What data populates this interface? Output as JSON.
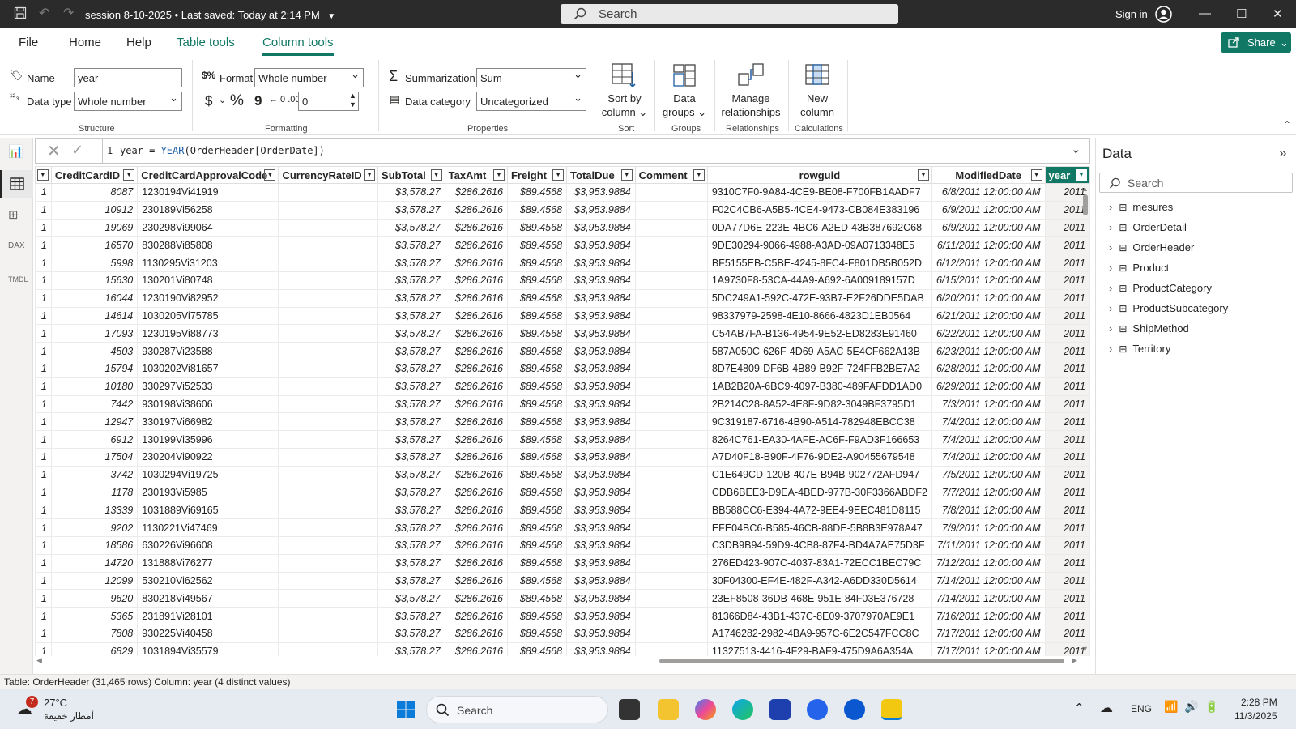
{
  "titlebar": {
    "title": "session 8-10-2025",
    "saved": "Last saved: Today at 2:14 PM",
    "search_placeholder": "Search",
    "signin": "Sign in"
  },
  "menu": {
    "items": [
      "File",
      "Home",
      "Help",
      "Table tools",
      "Column tools"
    ],
    "share": "Share"
  },
  "ribbon": {
    "structure": {
      "name_label": "Name",
      "name_value": "year",
      "datatype_label": "Data type",
      "datatype_value": "Whole number",
      "group": "Structure"
    },
    "formatting": {
      "format_label": "Format",
      "format_value": "Whole number",
      "currency_symbol": "$",
      "percent_symbol": "%",
      "comma_symbol": "9",
      "decimals_value": "0",
      "group": "Formatting"
    },
    "properties": {
      "summarization_label": "Summarization",
      "summarization_value": "Sum",
      "category_label": "Data category",
      "category_value": "Uncategorized",
      "group": "Properties"
    },
    "sort": {
      "btn1": "Sort by",
      "btn2": "column",
      "group": "Sort"
    },
    "groups": {
      "btn1": "Data",
      "btn2": "groups",
      "group": "Groups"
    },
    "relationships": {
      "btn1": "Manage",
      "btn2": "relationships",
      "group": "Relationships"
    },
    "calculations": {
      "btn1": "New",
      "btn2": "column",
      "group": "Calculations"
    }
  },
  "formula": {
    "line": "1",
    "lhs": "year = ",
    "fn": "YEAR",
    "args": "(OrderHeader[OrderDate])"
  },
  "table": {
    "columns": [
      "CreditCardID",
      "CreditCardApprovalCode",
      "CurrencyRateID",
      "SubTotal",
      "TaxAmt",
      "Freight",
      "TotalDue",
      "Comment",
      "rowguid",
      "ModifiedDate",
      "year"
    ],
    "rows": [
      [
        "1",
        "8087",
        "1230194Vi41919",
        "",
        "$3,578.27",
        "$286.2616",
        "$89.4568",
        "$3,953.9884",
        "",
        "9310C7F0-9A84-4CE9-BE08-F700FB1AADF7",
        "6/8/2011 12:00:00 AM",
        "2011"
      ],
      [
        "1",
        "10912",
        "230189Vi56258",
        "",
        "$3,578.27",
        "$286.2616",
        "$89.4568",
        "$3,953.9884",
        "",
        "F02C4CB6-A5B5-4CE4-9473-CB084E383196",
        "6/9/2011 12:00:00 AM",
        "2011"
      ],
      [
        "1",
        "19069",
        "230298Vi99064",
        "",
        "$3,578.27",
        "$286.2616",
        "$89.4568",
        "$3,953.9884",
        "",
        "0DA77D6E-223E-4BC6-A2ED-43B387692C68",
        "6/9/2011 12:00:00 AM",
        "2011"
      ],
      [
        "1",
        "16570",
        "830288Vi85808",
        "",
        "$3,578.27",
        "$286.2616",
        "$89.4568",
        "$3,953.9884",
        "",
        "9DE30294-9066-4988-A3AD-09A0713348E5",
        "6/11/2011 12:00:00 AM",
        "2011"
      ],
      [
        "1",
        "5998",
        "1130295Vi31203",
        "",
        "$3,578.27",
        "$286.2616",
        "$89.4568",
        "$3,953.9884",
        "",
        "BF5155EB-C5BE-4245-8FC4-F801DB5B052D",
        "6/12/2011 12:00:00 AM",
        "2011"
      ],
      [
        "1",
        "15630",
        "130201Vi80748",
        "",
        "$3,578.27",
        "$286.2616",
        "$89.4568",
        "$3,953.9884",
        "",
        "1A9730F8-53CA-44A9-A692-6A009189157D",
        "6/15/2011 12:00:00 AM",
        "2011"
      ],
      [
        "1",
        "16044",
        "1230190Vi82952",
        "",
        "$3,578.27",
        "$286.2616",
        "$89.4568",
        "$3,953.9884",
        "",
        "5DC249A1-592C-472E-93B7-E2F26DDE5DAB",
        "6/20/2011 12:00:00 AM",
        "2011"
      ],
      [
        "1",
        "14614",
        "1030205Vi75785",
        "",
        "$3,578.27",
        "$286.2616",
        "$89.4568",
        "$3,953.9884",
        "",
        "98337979-2598-4E10-8666-4823D1EB0564",
        "6/21/2011 12:00:00 AM",
        "2011"
      ],
      [
        "1",
        "17093",
        "1230195Vi88773",
        "",
        "$3,578.27",
        "$286.2616",
        "$89.4568",
        "$3,953.9884",
        "",
        "C54AB7FA-B136-4954-9E52-ED8283E91460",
        "6/22/2011 12:00:00 AM",
        "2011"
      ],
      [
        "1",
        "4503",
        "930287Vi23588",
        "",
        "$3,578.27",
        "$286.2616",
        "$89.4568",
        "$3,953.9884",
        "",
        "587A050C-626F-4D69-A5AC-5E4CF662A13B",
        "6/23/2011 12:00:00 AM",
        "2011"
      ],
      [
        "1",
        "15794",
        "1030202Vi81657",
        "",
        "$3,578.27",
        "$286.2616",
        "$89.4568",
        "$3,953.9884",
        "",
        "8D7E4809-DF6B-4B89-B92F-724FFB2BE7A2",
        "6/28/2011 12:00:00 AM",
        "2011"
      ],
      [
        "1",
        "10180",
        "330297Vi52533",
        "",
        "$3,578.27",
        "$286.2616",
        "$89.4568",
        "$3,953.9884",
        "",
        "1AB2B20A-6BC9-4097-B380-489FAFDD1AD0",
        "6/29/2011 12:00:00 AM",
        "2011"
      ],
      [
        "1",
        "7442",
        "930198Vi38606",
        "",
        "$3,578.27",
        "$286.2616",
        "$89.4568",
        "$3,953.9884",
        "",
        "2B214C28-8A52-4E8F-9D82-3049BF3795D1",
        "7/3/2011 12:00:00 AM",
        "2011"
      ],
      [
        "1",
        "12947",
        "330197Vi66982",
        "",
        "$3,578.27",
        "$286.2616",
        "$89.4568",
        "$3,953.9884",
        "",
        "9C319187-6716-4B90-A514-782948EBCC38",
        "7/4/2011 12:00:00 AM",
        "2011"
      ],
      [
        "1",
        "6912",
        "130199Vi35996",
        "",
        "$3,578.27",
        "$286.2616",
        "$89.4568",
        "$3,953.9884",
        "",
        "8264C761-EA30-4AFE-AC6F-F9AD3F166653",
        "7/4/2011 12:00:00 AM",
        "2011"
      ],
      [
        "1",
        "17504",
        "230204Vi90922",
        "",
        "$3,578.27",
        "$286.2616",
        "$89.4568",
        "$3,953.9884",
        "",
        "A7D40F18-B90F-4F76-9DE2-A90455679548",
        "7/4/2011 12:00:00 AM",
        "2011"
      ],
      [
        "1",
        "3742",
        "1030294Vi19725",
        "",
        "$3,578.27",
        "$286.2616",
        "$89.4568",
        "$3,953.9884",
        "",
        "C1E649CD-120B-407E-B94B-902772AFD947",
        "7/5/2011 12:00:00 AM",
        "2011"
      ],
      [
        "1",
        "1178",
        "230193Vi5985",
        "",
        "$3,578.27",
        "$286.2616",
        "$89.4568",
        "$3,953.9884",
        "",
        "CDB6BEE3-D9EA-4BED-977B-30F3366ABDF2",
        "7/7/2011 12:00:00 AM",
        "2011"
      ],
      [
        "1",
        "13339",
        "1031889Vi69165",
        "",
        "$3,578.27",
        "$286.2616",
        "$89.4568",
        "$3,953.9884",
        "",
        "BB588CC6-E394-4A72-9EE4-9EEC481D8115",
        "7/8/2011 12:00:00 AM",
        "2011"
      ],
      [
        "1",
        "9202",
        "1130221Vi47469",
        "",
        "$3,578.27",
        "$286.2616",
        "$89.4568",
        "$3,953.9884",
        "",
        "EFE04BC6-B585-46CB-88DE-5B8B3E978A47",
        "7/9/2011 12:00:00 AM",
        "2011"
      ],
      [
        "1",
        "18586",
        "630226Vi96608",
        "",
        "$3,578.27",
        "$286.2616",
        "$89.4568",
        "$3,953.9884",
        "",
        "C3DB9B94-59D9-4CB8-87F4-BD4A7AE75D3F",
        "7/11/2011 12:00:00 AM",
        "2011"
      ],
      [
        "1",
        "14720",
        "131888Vi76277",
        "",
        "$3,578.27",
        "$286.2616",
        "$89.4568",
        "$3,953.9884",
        "",
        "276ED423-907C-4037-83A1-72ECC1BEC79C",
        "7/12/2011 12:00:00 AM",
        "2011"
      ],
      [
        "1",
        "12099",
        "530210Vi62562",
        "",
        "$3,578.27",
        "$286.2616",
        "$89.4568",
        "$3,953.9884",
        "",
        "30F04300-EF4E-482F-A342-A6DD330D5614",
        "7/14/2011 12:00:00 AM",
        "2011"
      ],
      [
        "1",
        "9620",
        "830218Vi49567",
        "",
        "$3,578.27",
        "$286.2616",
        "$89.4568",
        "$3,953.9884",
        "",
        "23EF8508-36DB-468E-951E-84F03E376728",
        "7/14/2011 12:00:00 AM",
        "2011"
      ],
      [
        "1",
        "5365",
        "231891Vi28101",
        "",
        "$3,578.27",
        "$286.2616",
        "$89.4568",
        "$3,953.9884",
        "",
        "81366D84-43B1-437C-8E09-3707970AE9E1",
        "7/16/2011 12:00:00 AM",
        "2011"
      ],
      [
        "1",
        "7808",
        "930225Vi40458",
        "",
        "$3,578.27",
        "$286.2616",
        "$89.4568",
        "$3,953.9884",
        "",
        "A1746282-2982-4BA9-957C-6E2C547FCC8C",
        "7/17/2011 12:00:00 AM",
        "2011"
      ],
      [
        "1",
        "6829",
        "1031894Vi35579",
        "",
        "$3,578.27",
        "$286.2616",
        "$89.4568",
        "$3,953.9884",
        "",
        "11327513-4416-4F29-BAF9-475D9A6A354A",
        "7/17/2011 12:00:00 AM",
        "2011"
      ]
    ]
  },
  "datapanel": {
    "title": "Data",
    "search_placeholder": "Search",
    "tables": [
      "mesures",
      "OrderDetail",
      "OrderHeader",
      "Product",
      "ProductCategory",
      "ProductSubcategory",
      "ShipMethod",
      "Territory"
    ]
  },
  "status": "Table: OrderHeader (31,465 rows) Column: year (4 distinct values)",
  "taskbar": {
    "temp": "27°C",
    "weather": "أمطار خفيفة",
    "badge": "7",
    "search": "Search",
    "lang": "ENG",
    "time": "2:28 PM",
    "date": "11/3/2025"
  },
  "colors": {
    "accent": "#117865",
    "titlebar": "#2b2b2b"
  }
}
